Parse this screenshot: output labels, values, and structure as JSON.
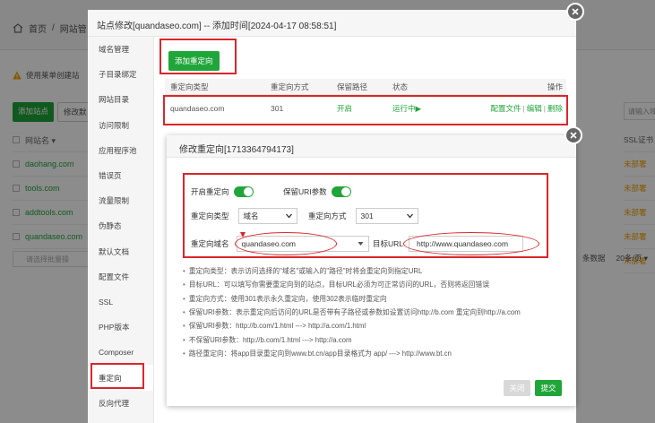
{
  "background": {
    "breadcrumb": [
      "首页",
      "/",
      "网站管"
    ],
    "warning_text": "使用莱单创建站",
    "toolbar": {
      "add_site": "添加站点",
      "modify": "修改默"
    },
    "table_header": "网站名 ▾",
    "sites": [
      "daohang.com",
      "tools.com",
      "addtools.com",
      "quandaseo.com"
    ],
    "search_placeholder": "请选择批量操",
    "right_search": "请输入域",
    "right_header": "SSL证书",
    "right_cells": [
      "未部署",
      "未部署",
      "未部署",
      "未部署",
      "未部署"
    ],
    "pager": [
      "条数据",
      "20条/页 ▾"
    ]
  },
  "outer_dialog": {
    "title": "站点修改[quandaseo.com] -- 添加时间[2024-04-17 08:58:51]",
    "nav": [
      "域名管理",
      "子目录绑定",
      "网站目录",
      "访问限制",
      "应用程序池",
      "错误页",
      "流量限制",
      "伪静态",
      "默认文档",
      "配置文件",
      "SSL",
      "PHP版本",
      "Composer",
      "重定向",
      "反向代理"
    ],
    "active_nav": "重定向",
    "add_redirect_button": "添加重定向",
    "table": {
      "headers": [
        "重定向类型",
        "重定向方式",
        "保留路径",
        "状态",
        "操作"
      ],
      "rows": [
        {
          "type": "quandaseo.com",
          "method": "301",
          "keep_path": "开启",
          "status": "运行中▶",
          "op_config": "配置文件",
          "op_edit": "编辑",
          "op_delete": "删除",
          "sep": "|"
        }
      ]
    }
  },
  "inner_dialog": {
    "title": "修改重定向[1713364794173]",
    "enable_label": "开启重定向",
    "keep_uri_label": "保留URI参数",
    "type_label": "重定向类型",
    "type_value": "域名",
    "method_label": "重定向方式",
    "method_value": "301",
    "domain_label": "重定向域名",
    "domain_value": "quandaseo.com",
    "target_label": "目标URL",
    "target_value": "http://www.quandaseo.com",
    "hints": [
      "重定向类型：表示访问选择的\"域名\"或输入的\"路径\"时将会重定向到指定URL",
      "目标URL：可以填写你需要重定向到的站点，目标URL必须为可正常访问的URL，否则将返回错误",
      "重定向方式：使用301表示永久重定向，使用302表示临时重定向",
      "保留URI参数：表示重定向后访问的URL是否带有子路径或参数如设置访问http://b.com 重定向到http://a.com",
      "保留URI参数：http://b.com/1.html ---> http://a.com/1.html",
      "不保留URI参数：http://b.com/1.html ---> http://a.com",
      "路径重定向：将app目录重定向到www.bt.cn/app目录格式为 app/ ---> http://www.bt.cn"
    ],
    "close_button": "关闭",
    "submit_button": "提交"
  },
  "colors": {
    "brand_green": "#20a53a",
    "annotation_red": "#d9262c",
    "warning_orange": "#f0a000"
  }
}
